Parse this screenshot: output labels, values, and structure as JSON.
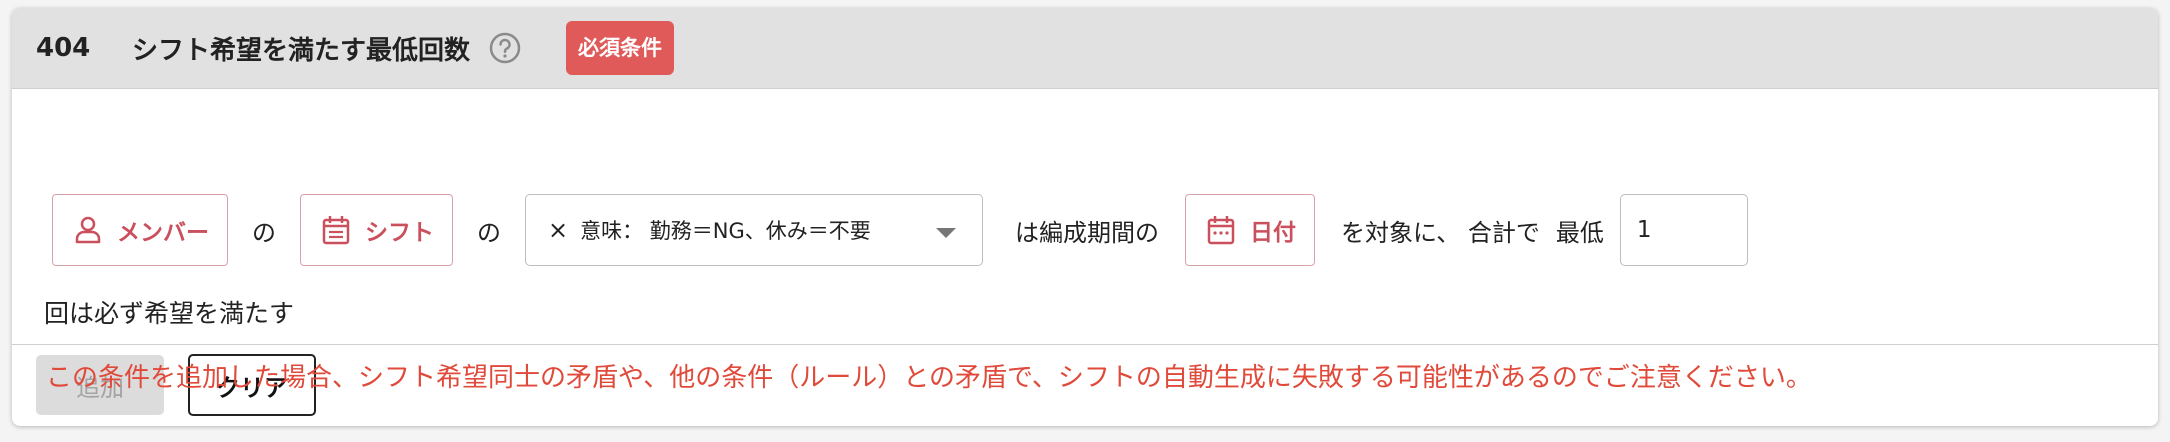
{
  "header": {
    "rule_id": "404",
    "title": "シフト希望を満たす最低回数",
    "badge": "必須条件"
  },
  "condition": {
    "member_chip": "メンバー",
    "particle_no": "の",
    "shift_chip": "シフト",
    "particle_no2": "の",
    "meaning_select": {
      "remove_symbol": "×",
      "value": "意味： 勤務＝NG、休み＝不要"
    },
    "text_period": "は編成期間の",
    "date_chip": "日付",
    "text_target": "を対象に、 合計で",
    "text_min": "最低",
    "min_count_value": "1",
    "text_suffix": "回は必ず希望を満たす"
  },
  "warning": "この条件を追加した場合、シフト希望同士の矛盾や、他の条件（ルール）との矛盾で、シフトの自動生成に失敗する可能性があるのでご注意ください。",
  "footer": {
    "add_label": "追加",
    "clear_label": "クリア"
  },
  "colors": {
    "accent": "#c9505c",
    "badge": "#e05a5a",
    "warning": "#e04a3a",
    "header_bg": "#e1e1e1"
  },
  "icons": {
    "help": "question-circle-icon",
    "member": "person-icon",
    "shift": "calendar-list-icon",
    "date": "calendar-icon",
    "select": "caret-down-icon"
  }
}
